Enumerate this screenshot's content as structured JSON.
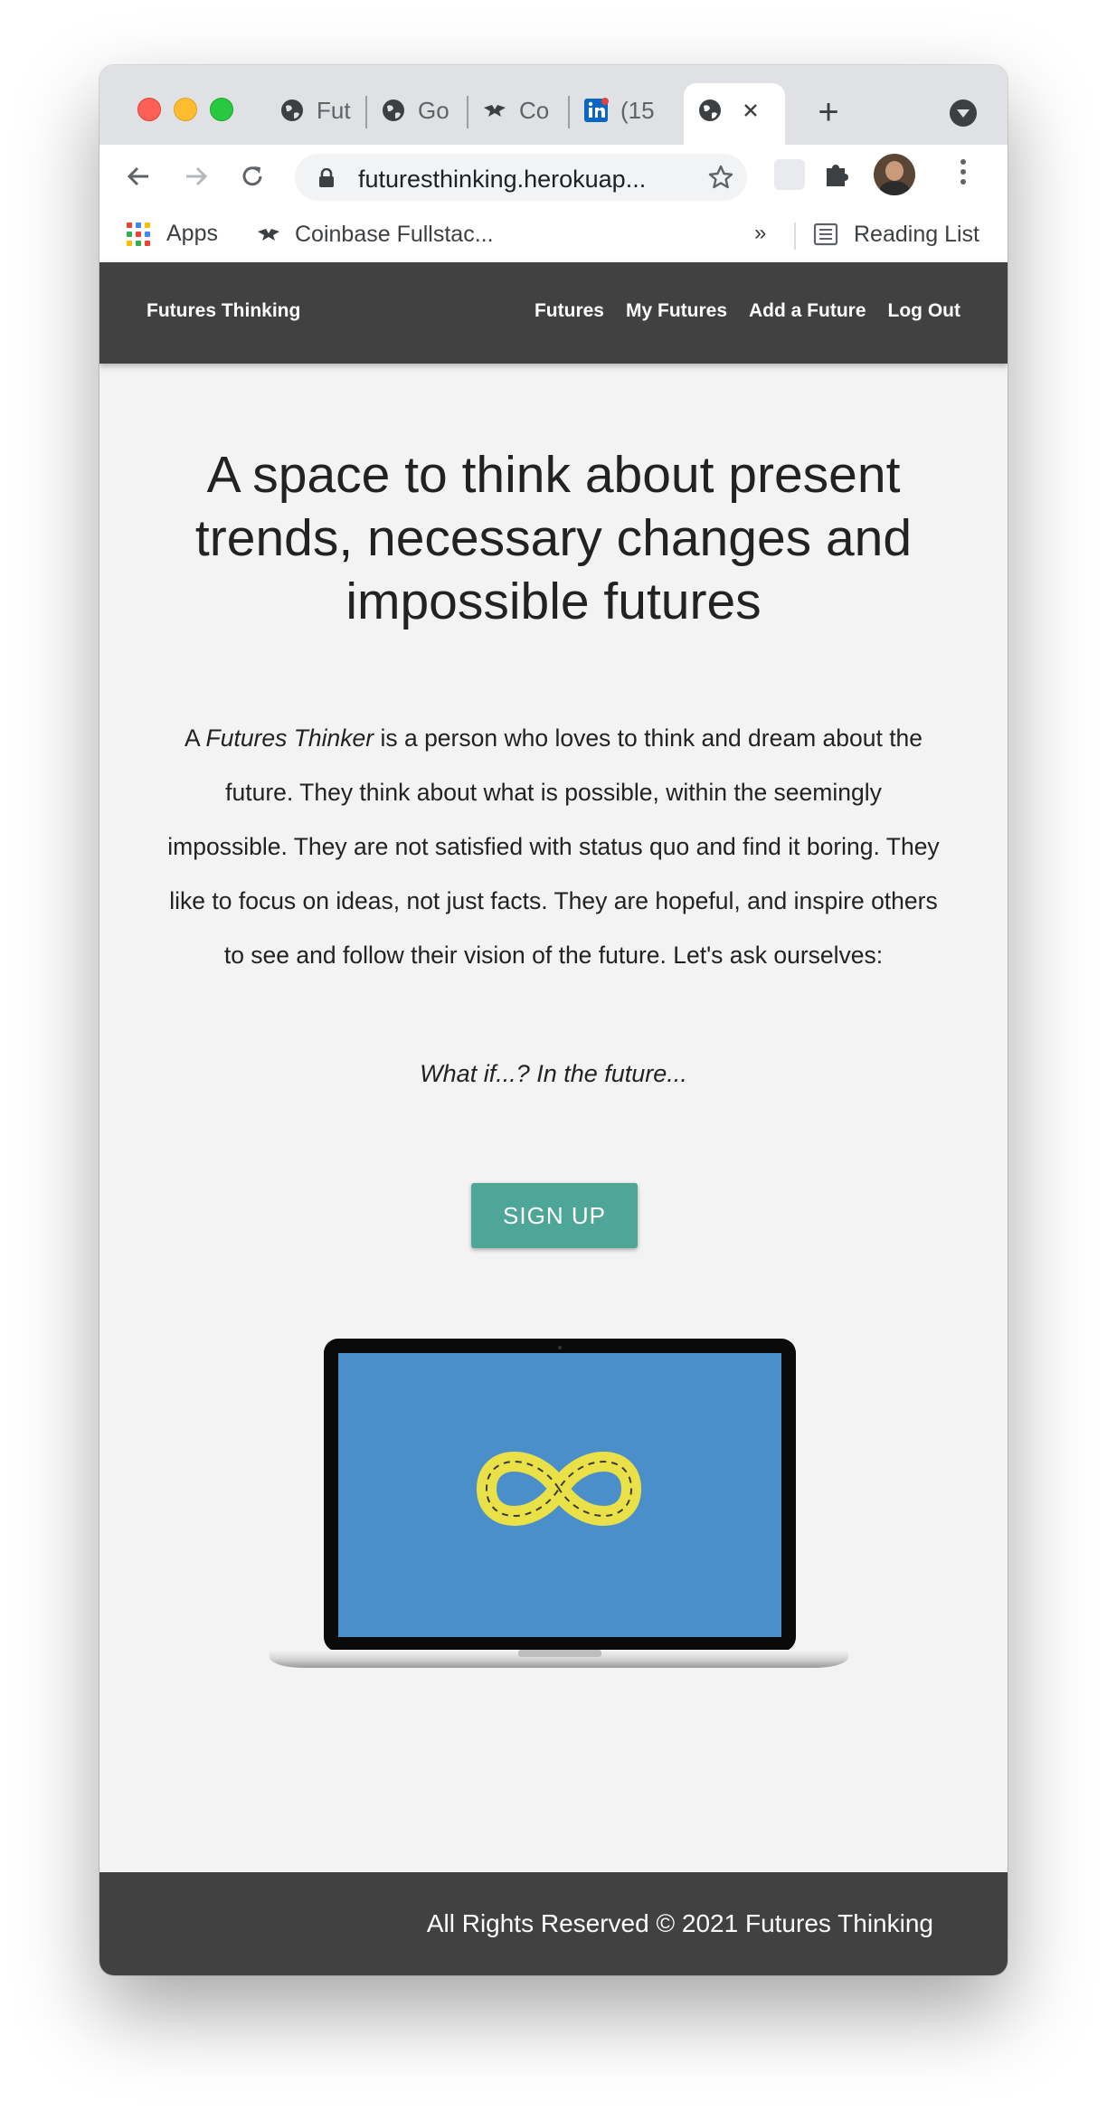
{
  "browser": {
    "tabs": [
      {
        "title": "Fut",
        "icon": "globe-icon"
      },
      {
        "title": "Go",
        "icon": "globe-icon"
      },
      {
        "title": "Co",
        "icon": "coinbase-logo-icon"
      },
      {
        "title": "(15",
        "icon": "linkedin-icon"
      },
      {
        "title": "",
        "icon": "globe-icon",
        "active": true
      }
    ],
    "url": "futuresthinking.herokuap...",
    "bookmarks": {
      "apps_label": "Apps",
      "coinbase_label": "Coinbase Fullstac...",
      "more_label": "»",
      "reading_list_label": "Reading List"
    }
  },
  "site": {
    "brand": "Futures Thinking",
    "nav": [
      "Futures",
      "My Futures",
      "Add a Future",
      "Log Out"
    ]
  },
  "main": {
    "headline": "A space to think about present trends, necessary changes and impossible futures",
    "intro_prefix": "A ",
    "intro_emphasis": "Futures Thinker",
    "intro_rest": " is a person who loves to think and dream about the future. They think about what is possible, within the seemingly impossible. They are not satisfied with status quo and find it boring. They like to focus on ideas, not just facts. They are hopeful, and inspire others to see and follow their vision of the future. Let's ask ourselves:",
    "question": "What if...? In the future...",
    "signup_label": "SIGN UP"
  },
  "footer": {
    "text": "All Rights Reserved © 2021 Futures Thinking"
  },
  "colors": {
    "nav_bg": "#414141",
    "page_bg": "#f3f3f3",
    "button": "#4ea698",
    "screen_blue": "#4a8fca",
    "infinity_yellow": "#e9e147"
  }
}
